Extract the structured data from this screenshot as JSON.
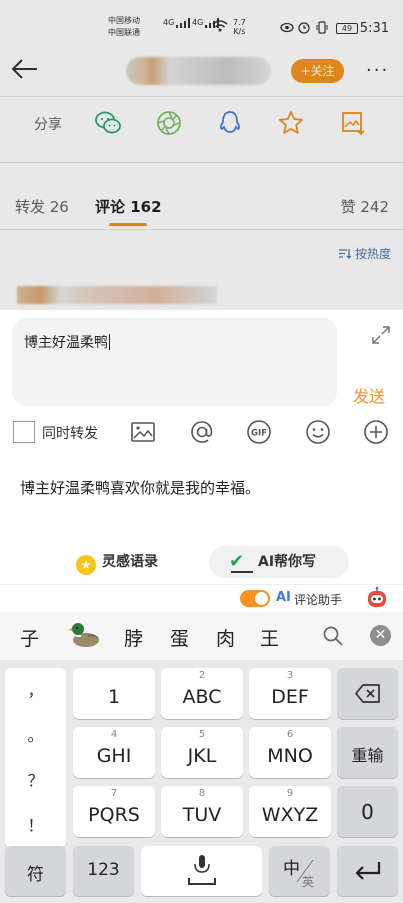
{
  "status_bar": {
    "carrier1": "中国移动",
    "carrier2": "中国联通",
    "net1": "4G",
    "net2": "4G",
    "speed": "7.7",
    "speed_unit": "K/s",
    "battery": "49",
    "time": "5:31"
  },
  "header": {
    "follow_label": "+关注",
    "more_label": "···"
  },
  "share": {
    "label": "分享",
    "icons": [
      "wechat-icon",
      "moments-icon",
      "qq-icon",
      "favorite-star-icon",
      "save-image-icon"
    ]
  },
  "tabs": {
    "repost": "转发 26",
    "comment": "评论 162",
    "like": "赞 242"
  },
  "sort_label": "按热度",
  "composer": {
    "input_value": "博主好温柔鸭",
    "send_label": "发送",
    "repost_checkbox_label": "同时转发",
    "suggestion": "博主好温柔鸭喜欢你就是我的幸福。",
    "inspire_label": "灵感语录",
    "ai_write_label": "AI帮你写",
    "ai_tag": "AI",
    "assistant_label": "评论助手",
    "assistant_enabled": true
  },
  "colors": {
    "accent": "#f7931e",
    "link_blue": "#4a78b5",
    "ai_blue": "#3a7be0"
  },
  "keyboard": {
    "candidates": [
      "子",
      "脖",
      "蛋",
      "肉",
      "王"
    ],
    "punctuation": [
      "，",
      "。",
      "？",
      "！"
    ],
    "keys": [
      {
        "num": "",
        "label": "1"
      },
      {
        "num": "2",
        "label": "ABC"
      },
      {
        "num": "3",
        "label": "DEF"
      },
      {
        "num": "4",
        "label": "GHI"
      },
      {
        "num": "5",
        "label": "JKL"
      },
      {
        "num": "6",
        "label": "MNO"
      },
      {
        "num": "7",
        "label": "PQRS"
      },
      {
        "num": "8",
        "label": "TUV"
      },
      {
        "num": "9",
        "label": "WXYZ"
      }
    ],
    "reinput_label": "重输",
    "zero_label": "0",
    "symbol_label": "符",
    "num_label": "123",
    "lang_main": "中",
    "lang_sub": "英"
  }
}
